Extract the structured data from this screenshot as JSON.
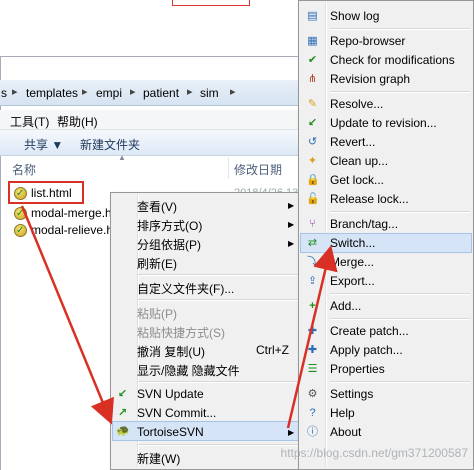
{
  "address": {
    "crumbs": [
      "s",
      "templates",
      "empi",
      "patient",
      "sim"
    ]
  },
  "menubar": {
    "tools": "工具(T)",
    "help": "帮助(H)"
  },
  "command_bar": {
    "share": "共享 ▼",
    "new_folder": "新建文件夹"
  },
  "columns": {
    "name": "名称",
    "modified": "修改日期"
  },
  "files": [
    {
      "name": "list.html"
    },
    {
      "name": "modal-merge.ht"
    },
    {
      "name": "modal-relieve.ht"
    }
  ],
  "file_date_fragment": "2018/4/26 13",
  "context_menu": {
    "view": "查看(V)",
    "sort": "排序方式(O)",
    "group": "分组依据(P)",
    "refresh": "刷新(E)",
    "customize": "自定义文件夹(F)...",
    "paste": "粘贴(P)",
    "paste_shortcut": "粘贴快捷方式(S)",
    "undo": "撤消 复制(U)",
    "undo_shortcut": "Ctrl+Z",
    "show_hidden": "显示/隐藏 隐藏文件",
    "svn_update": "SVN Update",
    "svn_commit": "SVN Commit...",
    "tortoisesvn": "TortoiseSVN",
    "new": "新建(W)"
  },
  "svn_menu": {
    "show_log": "Show log",
    "repo_browser": "Repo-browser",
    "check_mods": "Check for modifications",
    "revision_graph": "Revision graph",
    "resolve": "Resolve...",
    "update_rev": "Update to revision...",
    "revert": "Revert...",
    "cleanup": "Clean up...",
    "get_lock": "Get lock...",
    "release_lock": "Release lock...",
    "branch_tag": "Branch/tag...",
    "switch": "Switch...",
    "merge": "Merge...",
    "export": "Export...",
    "add": "Add...",
    "create_patch": "Create patch...",
    "apply_patch": "Apply patch...",
    "properties": "Properties",
    "settings": "Settings",
    "help": "Help",
    "about": "About"
  },
  "watermark": "https://blog.csdn.net/gm371200587",
  "colors": {
    "highlight": "#d5e4f6",
    "annotation_red": "#d93025",
    "menu_bg": "#f0f0f0"
  }
}
